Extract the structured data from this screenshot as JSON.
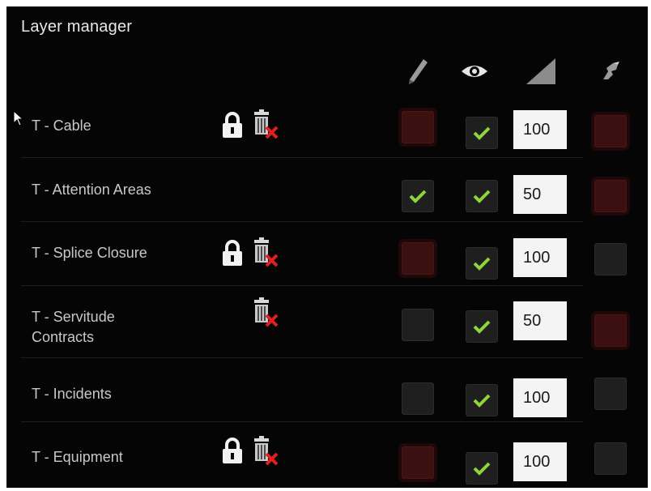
{
  "title": "Layer manager",
  "header_icons": [
    "edit-pencil-icon",
    "eye-visibility-icon",
    "opacity-triangle-icon",
    "snap-icon"
  ],
  "layers": [
    {
      "name": "T - Cable",
      "locked": true,
      "deletable": true,
      "editable": false,
      "edit_disabled": true,
      "visible": true,
      "opacity": "100",
      "snap": false,
      "snap_disabled": true
    },
    {
      "name": "T - Attention Areas",
      "locked": false,
      "deletable": false,
      "editable": true,
      "edit_disabled": false,
      "visible": true,
      "opacity": "50",
      "snap": false,
      "snap_disabled": true
    },
    {
      "name": "T - Splice Closure",
      "locked": true,
      "deletable": true,
      "editable": false,
      "edit_disabled": true,
      "visible": true,
      "opacity": "100",
      "snap": false,
      "snap_disabled": false
    },
    {
      "name": "T - Servitude Contracts",
      "locked": false,
      "deletable": true,
      "editable": false,
      "edit_disabled": false,
      "visible": true,
      "opacity": "50",
      "snap": false,
      "snap_disabled": true
    },
    {
      "name": "T - Incidents",
      "locked": false,
      "deletable": false,
      "editable": false,
      "edit_disabled": false,
      "visible": true,
      "opacity": "100",
      "snap": false,
      "snap_disabled": false
    },
    {
      "name": "T - Equipment",
      "locked": true,
      "deletable": true,
      "editable": false,
      "edit_disabled": true,
      "visible": true,
      "opacity": "100",
      "snap": false,
      "snap_disabled": false
    }
  ],
  "colors": {
    "check": "#8ed43a",
    "delete_x": "#e21e1e",
    "disabled_red": "#3a1010"
  }
}
